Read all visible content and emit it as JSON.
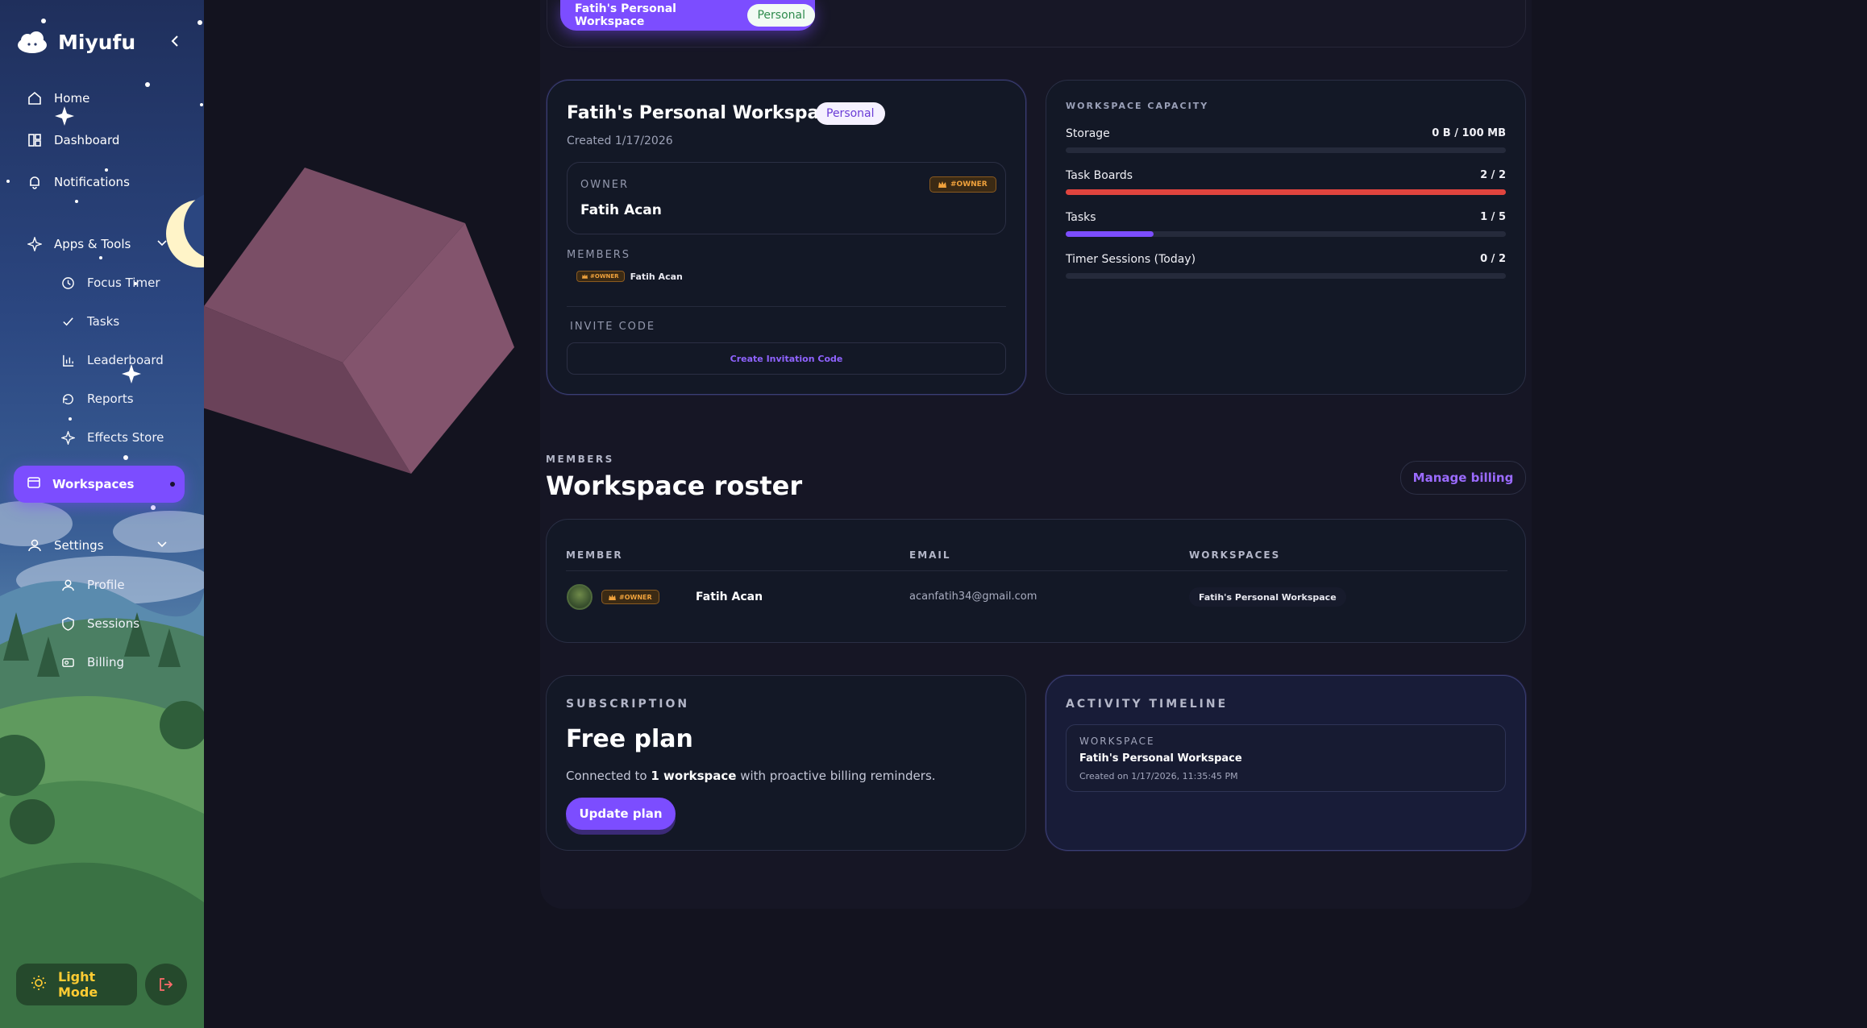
{
  "sidebar": {
    "brand": "Miyufu",
    "nav": [
      {
        "label": "Home",
        "icon": "home-icon"
      },
      {
        "label": "Dashboard",
        "icon": "dashboard-icon"
      },
      {
        "label": "Notifications",
        "icon": "bell-icon"
      }
    ],
    "apps": {
      "label": "Apps & Tools",
      "items": [
        {
          "label": "Focus Timer",
          "icon": "clock-icon"
        },
        {
          "label": "Tasks",
          "icon": "check-icon"
        },
        {
          "label": "Leaderboard",
          "icon": "bar-chart-icon"
        },
        {
          "label": "Reports",
          "icon": "report-icon"
        },
        {
          "label": "Effects Store",
          "icon": "sparkle-icon"
        }
      ]
    },
    "active": {
      "label": "Workspaces",
      "icon": "workspace-icon"
    },
    "settings": {
      "label": "Settings",
      "items": [
        {
          "label": "Profile",
          "icon": "user-icon"
        },
        {
          "label": "Sessions",
          "icon": "shield-icon"
        },
        {
          "label": "Billing",
          "icon": "billing-icon"
        }
      ]
    },
    "light_mode": "Light Mode"
  },
  "top_switcher": {
    "name": "Fatih's Personal Workspace",
    "badge": "Personal"
  },
  "workspace": {
    "title": "Fatih's Personal Workspace",
    "badge": "Personal",
    "created": "Created 1/17/2026",
    "owner_label": "OWNER",
    "owner_name": "Fatih Acan",
    "owner_tag": "#OWNER",
    "members_label": "MEMBERS",
    "member_tag": "#OWNER",
    "member_name": "Fatih Acan",
    "invite_label": "INVITE CODE",
    "invite_button": "Create Invitation Code"
  },
  "capacity": {
    "title": "WORKSPACE CAPACITY",
    "rows": [
      {
        "label": "Storage",
        "value": "0 B / 100 MB",
        "fraction": 0.0,
        "color": "#3b4157"
      },
      {
        "label": "Task Boards",
        "value": "2 / 2",
        "fraction": 1.0,
        "color": "#e0443e"
      },
      {
        "label": "Tasks",
        "value": "1 / 5",
        "fraction": 0.2,
        "color": "#7c4dff"
      },
      {
        "label": "Timer Sessions (Today)",
        "value": "0 / 2",
        "fraction": 0.0,
        "color": "#3b4157"
      }
    ]
  },
  "roster": {
    "kicker": "MEMBERS",
    "title": "Workspace roster",
    "billing_button": "Manage billing",
    "columns": [
      "MEMBER",
      "EMAIL",
      "WORKSPACES"
    ],
    "rows": [
      {
        "tag": "#OWNER",
        "name": "Fatih Acan",
        "email": "acanfatih34@gmail.com",
        "workspace": "Fatih's Personal Workspace"
      }
    ]
  },
  "subscription": {
    "kicker": "SUBSCRIPTION",
    "plan": "Free plan",
    "desc_pre": "Connected to ",
    "desc_bold": "1 workspace",
    "desc_post": " with proactive billing reminders.",
    "button": "Update plan"
  },
  "activity": {
    "kicker": "ACTIVITY TIMELINE",
    "type": "WORKSPACE",
    "name": "Fatih's Personal Workspace",
    "date": "Created on 1/17/2026, 11:35:45 PM"
  },
  "colors": {
    "accent": "#7c4dff",
    "danger": "#e0443e",
    "owner": "#f0a23c",
    "background": "#13131f"
  }
}
